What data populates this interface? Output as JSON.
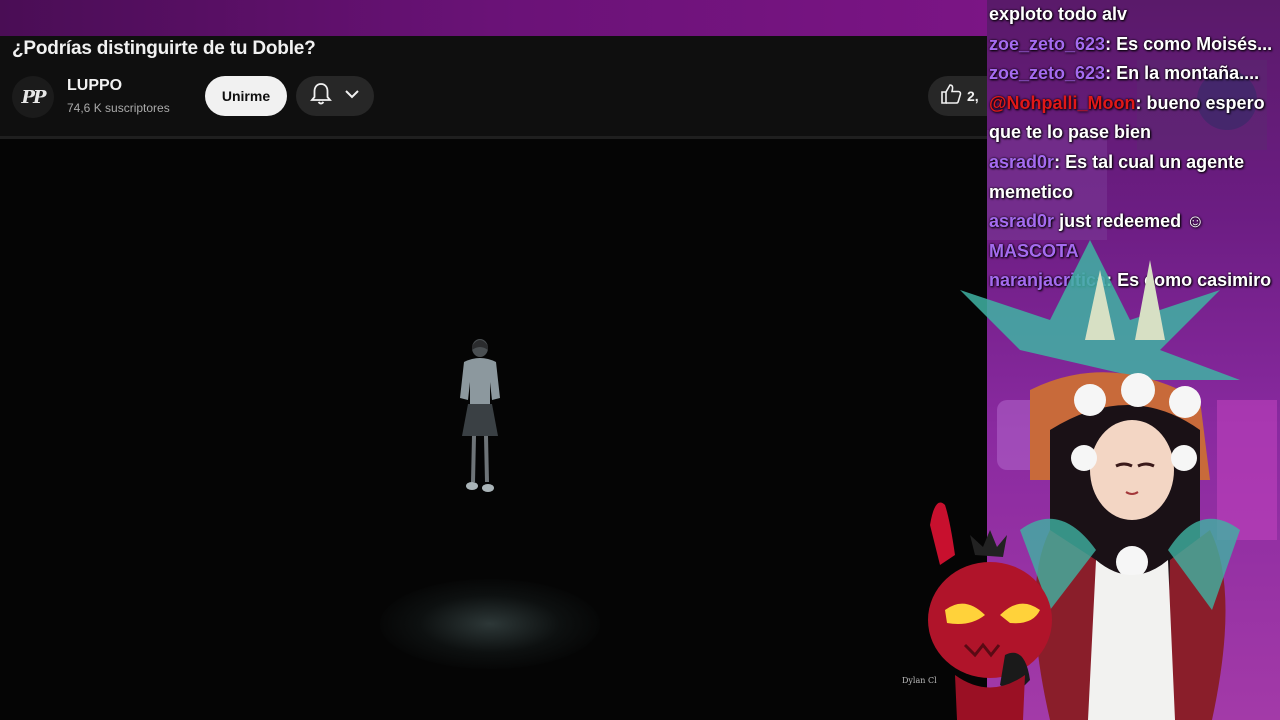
{
  "video": {
    "title": "¿Podrías distinguirte de tu Doble?",
    "channel_name": "LUPPO",
    "channel_avatar_text": "PP",
    "subscribers": "74,6 K suscriptores",
    "join_label": "Unirme",
    "like_count": "2,",
    "credit_text": "Dylan Cl"
  },
  "icons": {
    "bell": "bell-icon",
    "chevron": "chevron-down-icon",
    "like": "thumbs-up-icon"
  },
  "chat": {
    "messages": [
      {
        "user": "",
        "text": "exploto todo alv",
        "user_color": "#a56bf0"
      },
      {
        "user": "zoe_zeto_623",
        "sep": ": ",
        "text": "Es como Moisés...",
        "user_color": "#a56bf0"
      },
      {
        "user": "zoe_zeto_623",
        "sep": ": ",
        "text": "En la montaña....",
        "user_color": "#a56bf0"
      },
      {
        "user": "@Nohpalli_Moon",
        "sep": ": ",
        "text": "bueno espero que te lo pase bien",
        "user_color": "#e01818"
      },
      {
        "user": "asrad0r",
        "sep": ": ",
        "text": "Es tal cual un agente memetico",
        "user_color": "#a56bf0"
      },
      {
        "user": "asrad0r",
        "sep": " ",
        "text": "just redeemed ☺",
        "extra": "MASCOTA",
        "user_color": "#a56bf0"
      },
      {
        "user": "naranjacritica",
        "sep": ": ",
        "text": "Es como casimiro",
        "user_color": "#a56bf0"
      }
    ]
  },
  "colors": {
    "chat_user_violet": "#a56bf0",
    "chat_user_red": "#e01818",
    "youtube_bg": "#0f0f0f",
    "join_button_bg": "#f1f1f1",
    "stream_purple": "#6a1277"
  }
}
